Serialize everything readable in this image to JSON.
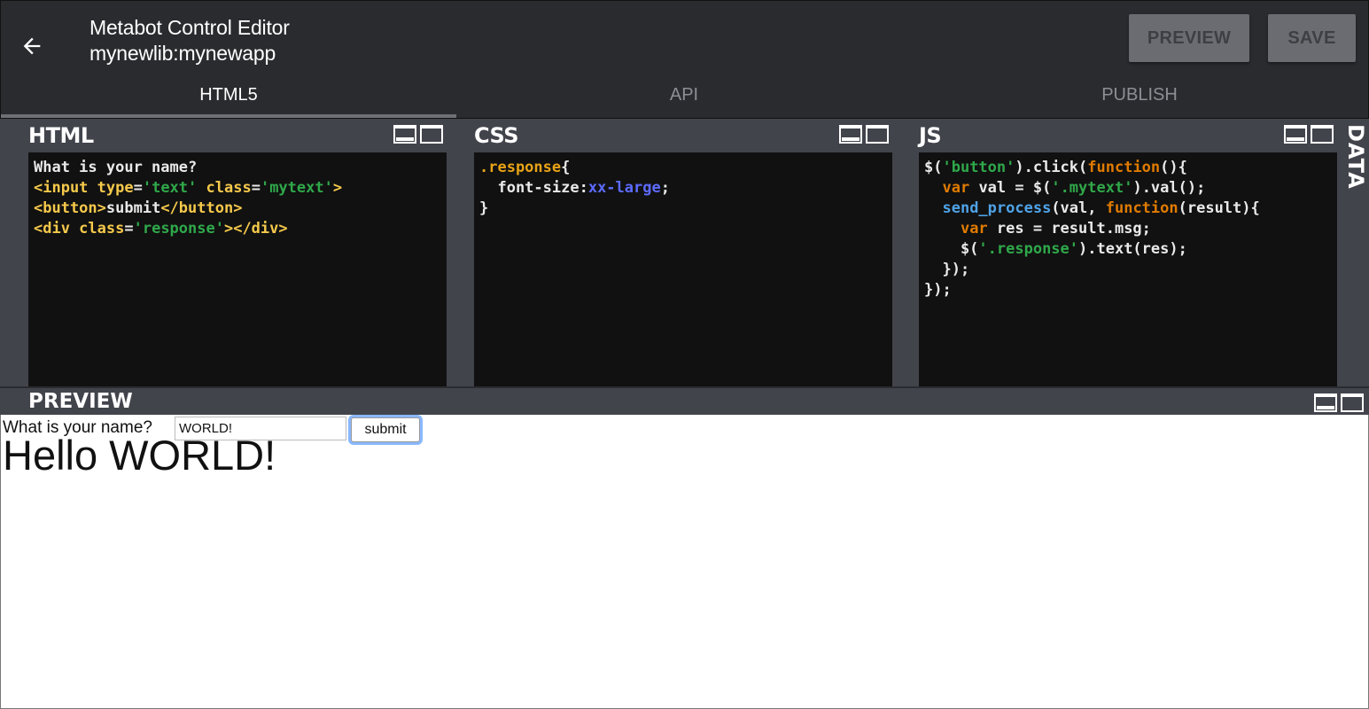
{
  "header": {
    "title": "Metabot Control Editor",
    "subtitle": "mynewlib:mynewapp",
    "back_icon": "arrow-left-icon",
    "preview_label": "PREVIEW",
    "save_label": "SAVE"
  },
  "tabs": [
    {
      "label": "HTML5",
      "active": true
    },
    {
      "label": "API",
      "active": false
    },
    {
      "label": "PUBLISH",
      "active": false
    }
  ],
  "panels": {
    "html": {
      "title": "HTML"
    },
    "css": {
      "title": "CSS"
    },
    "js": {
      "title": "JS"
    },
    "data": {
      "title": "DATA"
    }
  },
  "code": {
    "html": [
      [
        [
          "c-w",
          "What is your name?"
        ]
      ],
      [
        [
          "c-tag",
          "<input type"
        ],
        [
          "c-w",
          "="
        ],
        [
          "c-str",
          "'text'"
        ],
        [
          "c-w",
          " "
        ],
        [
          "c-tag",
          "class"
        ],
        [
          "c-w",
          "="
        ],
        [
          "c-str",
          "'mytext'"
        ],
        [
          "c-tag",
          ">"
        ]
      ],
      [
        [
          "c-tag",
          "<button>"
        ],
        [
          "c-w",
          "submit"
        ],
        [
          "c-tag",
          "</button>"
        ]
      ],
      [
        [
          "c-tag",
          "<div class"
        ],
        [
          "c-w",
          "="
        ],
        [
          "c-str",
          "'response'"
        ],
        [
          "c-tag",
          "></div>"
        ]
      ]
    ],
    "css": [
      [
        [
          "c-sel",
          ".response"
        ],
        [
          "c-w",
          "{"
        ]
      ],
      [
        [
          "c-w",
          "  font-size:"
        ],
        [
          "c-val",
          "xx-large"
        ],
        [
          "c-w",
          ";"
        ]
      ],
      [
        [
          "c-w",
          "}"
        ]
      ]
    ],
    "js": [
      [
        [
          "c-w",
          "$("
        ],
        [
          "c-str",
          "'button'"
        ],
        [
          "c-w",
          ").click("
        ],
        [
          "c-kw",
          "function"
        ],
        [
          "c-w",
          "(){"
        ]
      ],
      [
        [
          "c-w",
          "  "
        ],
        [
          "c-kw",
          "var"
        ],
        [
          "c-w",
          " val = $("
        ],
        [
          "c-str",
          "'.mytext'"
        ],
        [
          "c-w",
          ").val();"
        ]
      ],
      [
        [
          "c-w",
          "  "
        ],
        [
          "c-fn",
          "send_process"
        ],
        [
          "c-w",
          "(val, "
        ],
        [
          "c-kw",
          "function"
        ],
        [
          "c-w",
          "(result){"
        ]
      ],
      [
        [
          "c-w",
          "    "
        ],
        [
          "c-kw",
          "var"
        ],
        [
          "c-w",
          " res = result.msg;"
        ]
      ],
      [
        [
          "c-w",
          "    $("
        ],
        [
          "c-str",
          "'.response'"
        ],
        [
          "c-w",
          ").text(res);"
        ]
      ],
      [
        [
          "c-w",
          "  });"
        ]
      ],
      [
        [
          "c-w",
          "});"
        ]
      ]
    ]
  },
  "preview": {
    "title": "PREVIEW",
    "label": "What is your name?",
    "input_value": "WORLD!",
    "button_label": "submit",
    "response": "Hello WORLD!"
  },
  "icons": {
    "minimize": "minimize-panel-icon",
    "maximize": "maximize-panel-icon"
  }
}
